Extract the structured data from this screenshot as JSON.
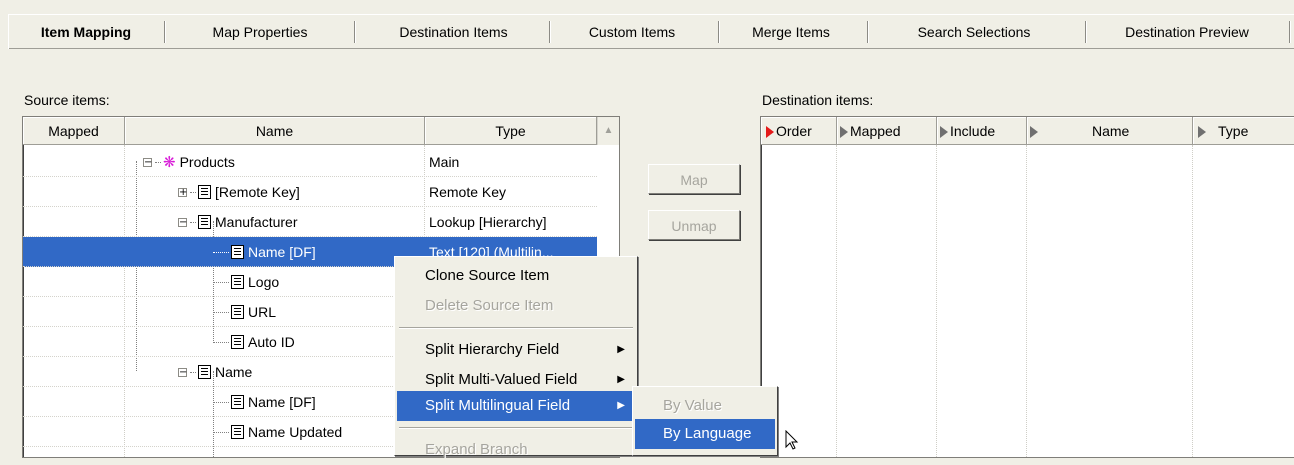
{
  "tabs": [
    {
      "label": "Item Mapping",
      "active": true
    },
    {
      "label": "Map Properties",
      "active": false
    },
    {
      "label": "Destination Items",
      "active": false
    },
    {
      "label": "Custom Items",
      "active": false
    },
    {
      "label": "Merge Items",
      "active": false
    },
    {
      "label": "Search Selections",
      "active": false
    },
    {
      "label": "Destination Preview",
      "active": false
    }
  ],
  "source": {
    "label": "Source items:",
    "columns": {
      "mapped": "Mapped",
      "name": "Name",
      "type": "Type"
    },
    "rows": [
      {
        "name": "Products",
        "type": "Main",
        "icon": "products-icon"
      },
      {
        "name": "[Remote Key]",
        "type": "Remote Key",
        "icon": "field-icon"
      },
      {
        "name": "Manufacturer",
        "type": "Lookup [Hierarchy]",
        "icon": "field-icon"
      },
      {
        "name": "Name [DF]",
        "type": "Text [120] (Multilin...",
        "icon": "field-icon",
        "selected": true
      },
      {
        "name": "Logo",
        "type": "",
        "icon": "field-icon"
      },
      {
        "name": "URL",
        "type": "",
        "icon": "field-icon"
      },
      {
        "name": "Auto ID",
        "type": "",
        "icon": "field-icon"
      },
      {
        "name": "Name",
        "type": "",
        "icon": "field-icon"
      },
      {
        "name": "Name [DF]",
        "type": "",
        "icon": "field-icon"
      },
      {
        "name": "Name Updated",
        "type": "",
        "icon": "field-icon"
      }
    ]
  },
  "buttons": {
    "map": "Map",
    "unmap": "Unmap"
  },
  "destination": {
    "label": "Destination items:",
    "columns": {
      "order": "Order",
      "mapped": "Mapped",
      "include": "Include",
      "name": "Name",
      "type": "Type"
    }
  },
  "context_menu": {
    "items": [
      {
        "label": "Clone Source Item",
        "disabled": false
      },
      {
        "label": "Delete Source Item",
        "disabled": true
      },
      {
        "label": "Split Hierarchy Field",
        "disabled": false,
        "submenu": true
      },
      {
        "label": "Split Multi-Valued Field",
        "disabled": false,
        "submenu": true
      },
      {
        "label": "Split Multilingual Field",
        "disabled": false,
        "submenu": true,
        "highlighted": true
      },
      {
        "label": "Expand Branch",
        "disabled": true
      }
    ]
  },
  "submenu": {
    "items": [
      {
        "label": "By Value",
        "disabled": true
      },
      {
        "label": "By Language",
        "disabled": false,
        "highlighted": true
      }
    ]
  },
  "colors": {
    "selection": "#3169c6",
    "accent_products": "#d81bd8",
    "sort_active": "#e41a1a"
  }
}
